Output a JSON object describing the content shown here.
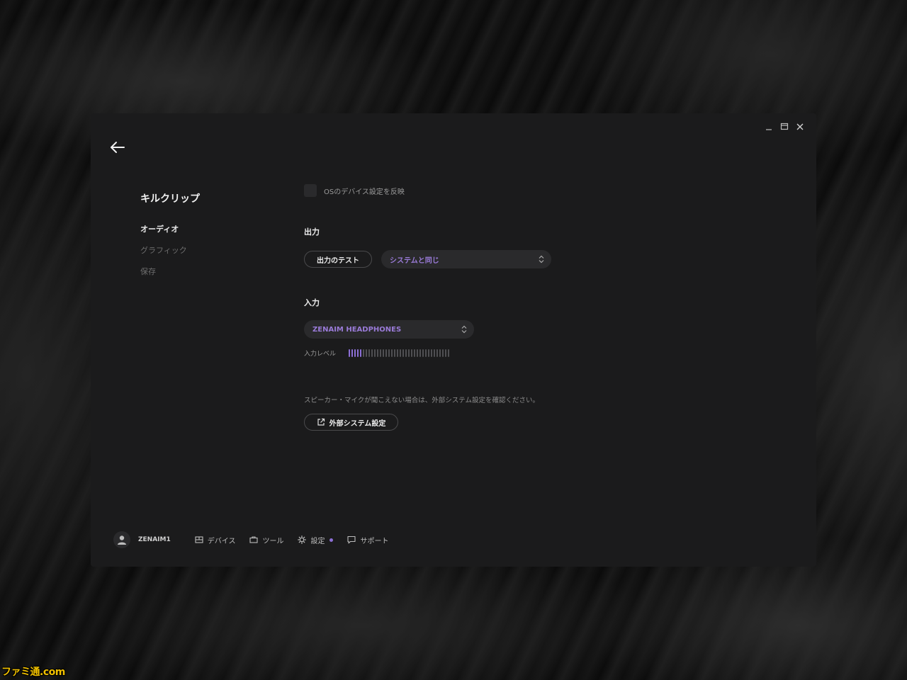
{
  "sidebar": {
    "title": "キルクリップ",
    "items": [
      {
        "label": "オーディオ",
        "active": true
      },
      {
        "label": "グラフィック",
        "active": false
      },
      {
        "label": "保存",
        "active": false
      }
    ]
  },
  "content": {
    "reflect_os_label": "OSのデバイス設定を反映",
    "output_title": "出力",
    "test_button": "出力のテスト",
    "output_select_value": "システムと同じ",
    "input_title": "入力",
    "input_select_value": "ZENAIM HEADPHONES",
    "level_label": "入力レベル",
    "level": {
      "active_bars": 5,
      "total_bars": 36
    },
    "help_text": "スピーカー・マイクが聞こえない場合は、外部システム設定を確認ください。",
    "external_button": "外部システム設定"
  },
  "footer": {
    "username": "ZENAIM1",
    "nav": [
      {
        "label": "デバイス",
        "icon": "device-icon"
      },
      {
        "label": "ツール",
        "icon": "toolbox-icon"
      },
      {
        "label": "設定",
        "icon": "gear-icon",
        "active_dot": true
      },
      {
        "label": "サポート",
        "icon": "chat-icon"
      }
    ]
  },
  "colors": {
    "accent": "#8c6fd6",
    "window_bg": "#1b1b1c",
    "control_bg": "#2a2a2c"
  },
  "watermark": "ファミ通.com"
}
